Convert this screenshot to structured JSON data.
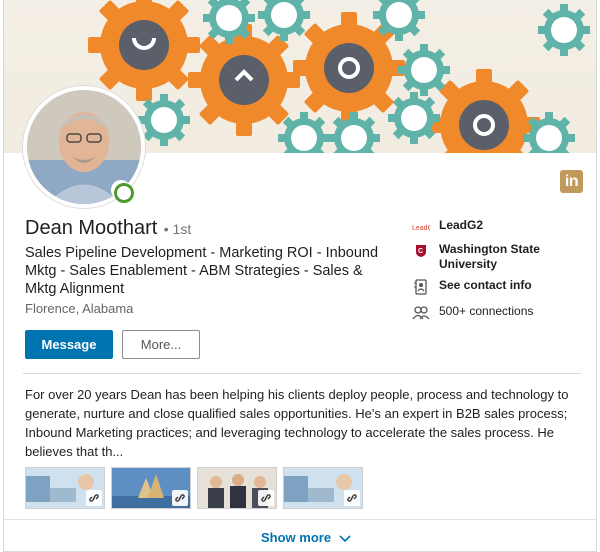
{
  "profile": {
    "name": "Dean Moothart",
    "degree": "• 1st",
    "headline": "Sales Pipeline Development - Marketing ROI - Inbound Mktg - Sales Enablement - ABM Strategies - Sales & Mktg Alignment",
    "location": "Florence, Alabama",
    "online_status": "online",
    "linkedin_badge": "in"
  },
  "actions": {
    "message_label": "Message",
    "more_label": "More..."
  },
  "side_info": [
    {
      "icon": "company-logo-icon",
      "text": "LeadG2",
      "bold": true
    },
    {
      "icon": "university-logo-icon",
      "text": "Washington State University",
      "bold": true
    },
    {
      "icon": "contact-card-icon",
      "text": "See contact info",
      "bold": true
    },
    {
      "icon": "connections-icon",
      "text": "500+ connections",
      "bold": false
    }
  ],
  "summary": {
    "text": "For over 20 years Dean has been helping his clients deploy people, process and technology to generate, nurture and close qualified sales opportunities. He's an expert in B2B sales process; Inbound Marketing practices; and leveraging technology to accelerate the sales process. He believes that th..."
  },
  "media": [
    {
      "icon": "link-icon"
    },
    {
      "icon": "link-icon"
    },
    {
      "icon": "link-icon"
    },
    {
      "icon": "link-icon"
    }
  ],
  "footer": {
    "show_more_label": "Show more"
  },
  "colors": {
    "primary": "#0073b1",
    "linkedin_badge": "#c19a5b",
    "online": "#4e9a2e",
    "gear_orange": "#f0892a",
    "gear_teal": "#5fb3a8"
  }
}
